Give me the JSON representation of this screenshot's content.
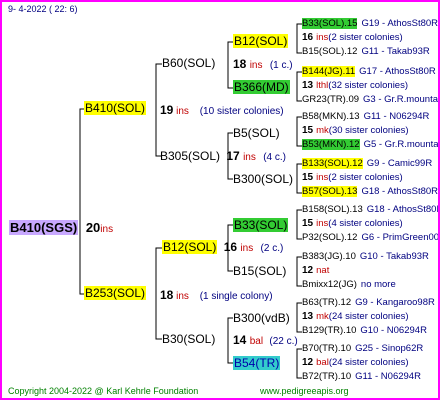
{
  "header": {
    "date": "9-  4-2022 (  22:  6)"
  },
  "root": {
    "name": "B410(SGS)",
    "count": "20",
    "ins": "ins",
    "highlight": "#c8a8ff"
  },
  "gen1": [
    {
      "name": "B410(SOL)",
      "count": "19",
      "ins": "ins",
      "note": "(10 sister colonies)",
      "highlight": "#ffff00"
    },
    {
      "name": "B253(SOL)",
      "count": "18",
      "ins": "ins",
      "note": "(1 single colony)",
      "highlight": "#ffff00"
    }
  ],
  "gen2": [
    {
      "name": "B60(SOL)"
    },
    {
      "name": "B305(SOL)",
      "count": "17",
      "ins": "ins",
      "note": "(4 c.)"
    },
    {
      "name": "B12(SOL)",
      "count": "16",
      "ins": "ins",
      "note": "(2 c.)",
      "highlight": "#ffff00"
    },
    {
      "name": "B30(SOL)"
    }
  ],
  "gen3": [
    {
      "name": "B12(SOL)",
      "count": "18",
      "ins": "ins",
      "note": "(1 c.)",
      "highlight": "#ffff00"
    },
    {
      "name": "B366(MD)",
      "highlight": "#33cc33"
    },
    {
      "name": "B5(SOL)"
    },
    {
      "name": "B300(SOL)"
    },
    {
      "name": "B33(SOL)",
      "highlight": "#33cc33"
    },
    {
      "name": "B15(SOL)"
    },
    {
      "name": "B300(vdB)",
      "count": "14",
      "ins": "bal",
      "note": "(22 c.)"
    },
    {
      "name": "B54(TR)",
      "highlight": "#33cccc"
    }
  ],
  "leaves": [
    {
      "left": "B33(SOL).15",
      "right": "G19 - AthosSt80R",
      "hl": "#33cc33"
    },
    {
      "count": "16",
      "ins": "ins",
      "note": "(2 sister colonies)"
    },
    {
      "left": "B15(SOL).12",
      "right": "G11 - Takab93R"
    },
    {
      "left": "B144(JG).11",
      "right": "G17 - AthosSt80R",
      "hl": "#ffff00"
    },
    {
      "count": "13",
      "ins": "lthl",
      "note": "(32 sister colonies)"
    },
    {
      "left": "GR23(TR).09",
      "right": "G3 - Gr.R.mounta"
    },
    {
      "left": "B58(MKN).13",
      "right": "G11 - N06294R"
    },
    {
      "count": "15",
      "ins": "mk",
      "note": "(30 sister colonies)"
    },
    {
      "left": "B53(MKN).12",
      "right": "G5 - Gr.R.mounta",
      "hl": "#33cc33"
    },
    {
      "left": "B133(SOL).12",
      "right": "G9 - Camic99R",
      "hl": "#ffff00"
    },
    {
      "count": "15",
      "ins": "ins",
      "note": "(2 sister colonies)"
    },
    {
      "left": "B57(SOL).13",
      "right": "G18 - AthosSt80R",
      "hl": "#ffff00"
    },
    {
      "left": "B158(SOL).13",
      "right": "G18 - AthosSt80R"
    },
    {
      "count": "15",
      "ins": "ins",
      "note": "(4 sister colonies)"
    },
    {
      "left": "P32(SOL).12",
      "right": "G6 - PrimGreen00"
    },
    {
      "left": "B383(JG).10",
      "right": "G10 - Takab93R"
    },
    {
      "count": "12",
      "ins": "nat",
      "note": ""
    },
    {
      "left": "Bmixx12(JG)",
      "right": "no more"
    },
    {
      "left": "B63(TR).12",
      "right": "G9 - Kangaroo98R"
    },
    {
      "count": "13",
      "ins": "mk",
      "note": "(24 sister colonies)"
    },
    {
      "left": "B129(TR).10",
      "right": "G10 - N06294R"
    },
    {
      "left": "B70(TR).10",
      "right": "G25 - Sinop62R"
    },
    {
      "count": "12",
      "ins": "bal",
      "note": "(24 sister colonies)"
    },
    {
      "left": "B72(TR).10",
      "right": "G11 - N06294R"
    }
  ],
  "footer": {
    "copyright": "Copyright 2004-2022 @ Karl Kehrle Foundation",
    "site": "www.pedigreeapis.org"
  }
}
